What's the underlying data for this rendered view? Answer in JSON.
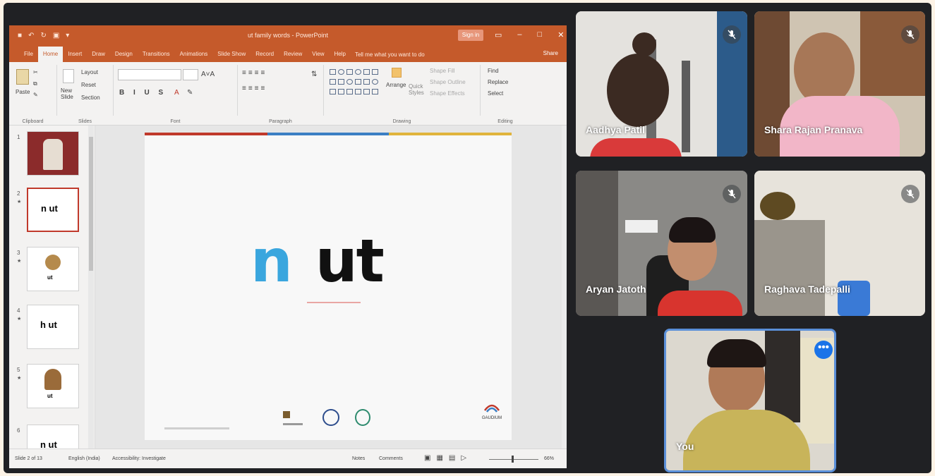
{
  "ppt": {
    "title": "ut family words - PowerPoint",
    "sign_in": "Sign in",
    "quick_access": [
      "■",
      "↶",
      "↻",
      "▣",
      "▾"
    ],
    "window_controls": [
      "▭",
      "–",
      "□",
      "✕"
    ],
    "tabs": [
      "File",
      "Home",
      "Insert",
      "Draw",
      "Design",
      "Transitions",
      "Animations",
      "Slide Show",
      "Record",
      "Review",
      "View",
      "Help"
    ],
    "active_tab": "Home",
    "tell_me": "Tell me what you want to do",
    "share": "Share",
    "ribbon": {
      "paste": "Paste",
      "new_slide": "New Slide",
      "layout": "Layout",
      "reset": "Reset",
      "section": "Section",
      "arrange": "Arrange",
      "quick_styles": "Quick Styles",
      "shape_fill": "Shape Fill",
      "shape_outline": "Shape Outline",
      "shape_effects": "Shape Effects",
      "find": "Find",
      "replace": "Replace",
      "select": "Select",
      "groups": [
        "Clipboard",
        "Slides",
        "Font",
        "Paragraph",
        "Drawing",
        "Editing"
      ]
    },
    "slide_numbers": [
      "1",
      "2",
      "3",
      "4",
      "5",
      "6"
    ],
    "thumb_words": [
      "",
      "n ut",
      "ut",
      "h ut",
      "ut",
      "n ut"
    ],
    "slide": {
      "letter_blue": "n",
      "letters_black": "ut",
      "brand": "GAUDIUM"
    },
    "status": {
      "slide_of": "Slide 2 of 13",
      "language": "English (India)",
      "accessibility": "Accessibility: Investigate",
      "notes": "Notes",
      "comments": "Comments",
      "zoom": "66%"
    }
  },
  "participants": [
    {
      "name": "Aadhya Patil",
      "muted": true
    },
    {
      "name": "Shara Rajan Pranava",
      "muted": true
    },
    {
      "name": "Aryan Jatoth",
      "muted": true
    },
    {
      "name": "Raghava Tadepalli",
      "muted": true
    },
    {
      "name": "You",
      "muted": false
    }
  ],
  "more_options": "•••",
  "colors": {
    "ppt_orange": "#c55a2b",
    "meet_bg": "#202124",
    "meet_blue": "#1a73e8",
    "stripe_red": "#c0392b",
    "stripe_blue": "#3b7fc4",
    "stripe_gold": "#e0b43c",
    "letter_blue": "#3aa6de"
  }
}
